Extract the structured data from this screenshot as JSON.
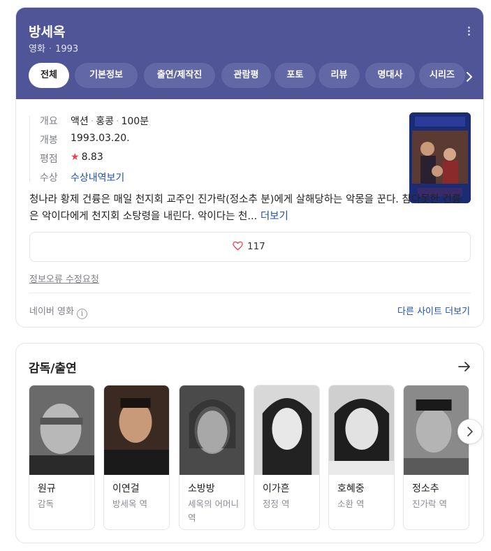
{
  "header": {
    "title": "방세옥",
    "subtitle_type": "영화",
    "subtitle_year": "1993",
    "background_color": "#4f5597"
  },
  "tabs": [
    "전체",
    "기본정보",
    "출연/제작진",
    "관람평",
    "포토",
    "리뷰",
    "명대사",
    "시리즈"
  ],
  "active_tab": "전체",
  "info": {
    "overview_label": "개요",
    "genre": "액션",
    "country": "홍콩",
    "runtime": "100분",
    "release_label": "개봉",
    "release_date": "1993.03.20.",
    "rating_label": "평점",
    "rating": "8.83",
    "award_label": "수상",
    "award_link": "수상내역보기"
  },
  "synopsis": {
    "text": "청나라 황제 건륭은 매일 천지회 교주인 진가락(정소추 분)에게 살해당하는 악몽을 꾼다. 참다못한 건륭은 악이다에게 천지회 소탕령을 내린다. 악이다는 천...",
    "more": "더보기"
  },
  "likes": {
    "count": "117",
    "icon": "heart-icon"
  },
  "report_link": "정보오류 수정요청",
  "source": {
    "label": "네이버 영화",
    "other_sites": "다른 사이트 더보기"
  },
  "cast_section": {
    "title": "감독/출연",
    "people": [
      {
        "name": "원규",
        "role": "감독"
      },
      {
        "name": "이연걸",
        "role": "방세옥 역"
      },
      {
        "name": "소방방",
        "role": "세옥의 어머니 역"
      },
      {
        "name": "이가흔",
        "role": "정정 역"
      },
      {
        "name": "호혜중",
        "role": "소환 역"
      },
      {
        "name": "정소추",
        "role": "진가락 역"
      }
    ]
  },
  "accent_link_color": "#1f4fb6",
  "star_color": "#f0414f"
}
